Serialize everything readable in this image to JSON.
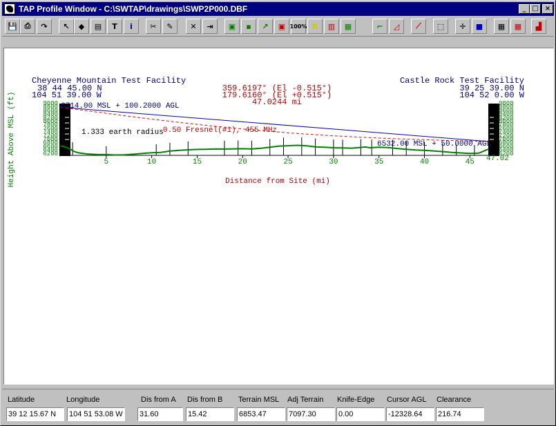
{
  "window": {
    "title": "TAP Profile Window - C:\\SWTAP\\drawings\\SWP2P000.DBF",
    "min_glyph": "_",
    "max_glyph": "□",
    "close_glyph": "×"
  },
  "toolbar": {
    "buttons": [
      {
        "name": "save-icon",
        "glyph": "💾"
      },
      {
        "name": "print-icon",
        "glyph": "⎙"
      },
      {
        "name": "redo-arrow-icon",
        "glyph": "↷"
      },
      {
        "name": "pointer-icon",
        "glyph": "↖"
      },
      {
        "name": "site-icon",
        "glyph": "◆"
      },
      {
        "name": "clipboard-icon",
        "glyph": "▤"
      },
      {
        "name": "text-icon",
        "glyph": "T"
      },
      {
        "name": "info-icon",
        "glyph": "i"
      },
      {
        "name": "knife-icon",
        "glyph": "✂"
      },
      {
        "name": "wrench-icon",
        "glyph": "✎"
      },
      {
        "name": "delete-icon",
        "glyph": "✕"
      },
      {
        "name": "move-icon",
        "glyph": "⇥"
      },
      {
        "name": "green-frame-icon",
        "glyph": "▣"
      },
      {
        "name": "green-square-icon",
        "glyph": "▪"
      },
      {
        "name": "antenna-icon",
        "glyph": "↗"
      },
      {
        "name": "red-frame-icon",
        "glyph": "▣"
      },
      {
        "name": "zoom-100-icon",
        "glyph": "100%"
      },
      {
        "name": "r-icon",
        "glyph": "R"
      },
      {
        "name": "red-box-icon",
        "glyph": "▥"
      },
      {
        "name": "green-box-icon",
        "glyph": "▦"
      },
      {
        "name": "step-chart-icon",
        "glyph": "⌐"
      },
      {
        "name": "slope-chart-icon",
        "glyph": "◿"
      },
      {
        "name": "slash-chart-icon",
        "glyph": "⟋"
      },
      {
        "name": "cursor-box-icon",
        "glyph": "⬚"
      },
      {
        "name": "crosshair-icon",
        "glyph": "✛"
      },
      {
        "name": "colors-icon",
        "glyph": "■"
      },
      {
        "name": "grid-icon",
        "glyph": "▦"
      },
      {
        "name": "color-grid-icon",
        "glyph": "▦"
      },
      {
        "name": "bar-chart-icon",
        "glyph": "▟"
      }
    ]
  },
  "profile": {
    "site_a": {
      "name": "Cheyenne Mountain Test Facility",
      "lat": "38 44 45.00 N",
      "lon": "104 51 39.00 W"
    },
    "site_b": {
      "name": "Castle Rock Test Facility",
      "lat": "39 25 39.00 N",
      "lon": "104 52 0.00 W"
    },
    "azimuth_1": "359.6197° (El -0.515°)",
    "azimuth_2": "179.6160° (El +0.515°)",
    "distance": "47.0244 mi",
    "antenna_a": "6714.00 MSL + 100.2000 AGL",
    "antenna_b": "6532.00 MSL + 50.0000 AGL",
    "earth_radius": "1.333 earth radius",
    "fresnel": "0.50 Fresnel(#1), 455 MHz",
    "y_axis_label": "Height Above MSL (ft)",
    "x_axis_label": "Distance from Site (mi)",
    "right_end_label": "47.02",
    "x_ticks": [
      "5",
      "10",
      "15",
      "20",
      "25",
      "30",
      "35",
      "40",
      "45"
    ]
  },
  "chart_data": {
    "type": "line",
    "title": "",
    "xlabel": "Distance from Site (mi)",
    "ylabel": "Height Above MSL (ft)",
    "xlim": [
      0,
      47.0244
    ],
    "ylim": [
      6200,
      9000
    ],
    "x_ticks": [
      5,
      10,
      15,
      20,
      25,
      30,
      35,
      40,
      45
    ],
    "grid": false,
    "series": [
      {
        "color": "#008000",
        "x": [
          0,
          0.5,
          1,
          1.5,
          2,
          3,
          4,
          5,
          6,
          7,
          8,
          9,
          10,
          11,
          12,
          13,
          14,
          15,
          16,
          17,
          18,
          19,
          20,
          21,
          22,
          23,
          24,
          25,
          26,
          27,
          28,
          29,
          30,
          31,
          32,
          33,
          33.5,
          34,
          35,
          36,
          37,
          38,
          39,
          40,
          41,
          42,
          43,
          44,
          45,
          46,
          47.02
        ],
        "y": [
          6714,
          6650,
          6550,
          6400,
          6330,
          6270,
          6250,
          6240,
          6220,
          6230,
          6260,
          6300,
          6340,
          6360,
          6430,
          6470,
          6500,
          6520,
          6530,
          6545,
          6540,
          6550,
          6560,
          6545,
          6580,
          6640,
          6700,
          6720,
          6740,
          6720,
          6660,
          6640,
          6610,
          6600,
          6590,
          6630,
          6650,
          6610,
          6640,
          6620,
          6570,
          6530,
          6490,
          6470,
          6440,
          6400,
          6360,
          6330,
          6300,
          6320,
          6532
        ]
      }
    ]
  },
  "status": {
    "fields": [
      {
        "label": "Latitude",
        "value": "39 12 15.67 N"
      },
      {
        "label": "Longitude",
        "value": "104 51 53.08 W"
      },
      {
        "label": "Dis from A",
        "value": "31.60"
      },
      {
        "label": "Dis from B",
        "value": "15.42"
      },
      {
        "label": "Terrain MSL",
        "value": "6853.47"
      },
      {
        "label": "Adj Terrain",
        "value": "7097.30"
      },
      {
        "label": "Knife-Edge",
        "value": "0.00"
      },
      {
        "label": "Cursor AGL",
        "value": "-12328.64"
      },
      {
        "label": "Clearance",
        "value": "216.74"
      }
    ]
  },
  "colors": {
    "title_bar": "#000080",
    "site_text": "#000080",
    "azimuth_text": "#c00000",
    "terrain": "#008000",
    "los_line": "#0000c0",
    "fresnel_line": "#ff0000",
    "axis_text": "#008000"
  }
}
